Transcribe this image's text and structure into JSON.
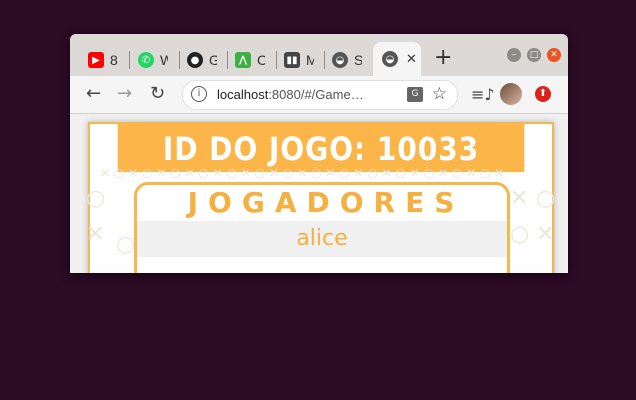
{
  "browser": {
    "tabs": [
      {
        "label": "8",
        "icon": "youtube-icon",
        "color": "#ff0000"
      },
      {
        "label": "W",
        "icon": "whatsapp-icon",
        "color": "#25d366"
      },
      {
        "label": "G",
        "icon": "github-icon",
        "color": "#222222"
      },
      {
        "label": "C",
        "icon": "codeship-icon",
        "color": "#3cb043"
      },
      {
        "label": "M",
        "icon": "trello-icon",
        "color": "#444444"
      },
      {
        "label": "S",
        "icon": "game-icon",
        "color": "#555555"
      }
    ],
    "active_tab": {
      "icon": "game-icon"
    },
    "url_host": "localhost",
    "url_rest": ":8080/#/Game…"
  },
  "page": {
    "game_id_label": "ID DO JOGO: 10033",
    "players_title": "JOGADORES",
    "players": [
      "alice"
    ]
  }
}
